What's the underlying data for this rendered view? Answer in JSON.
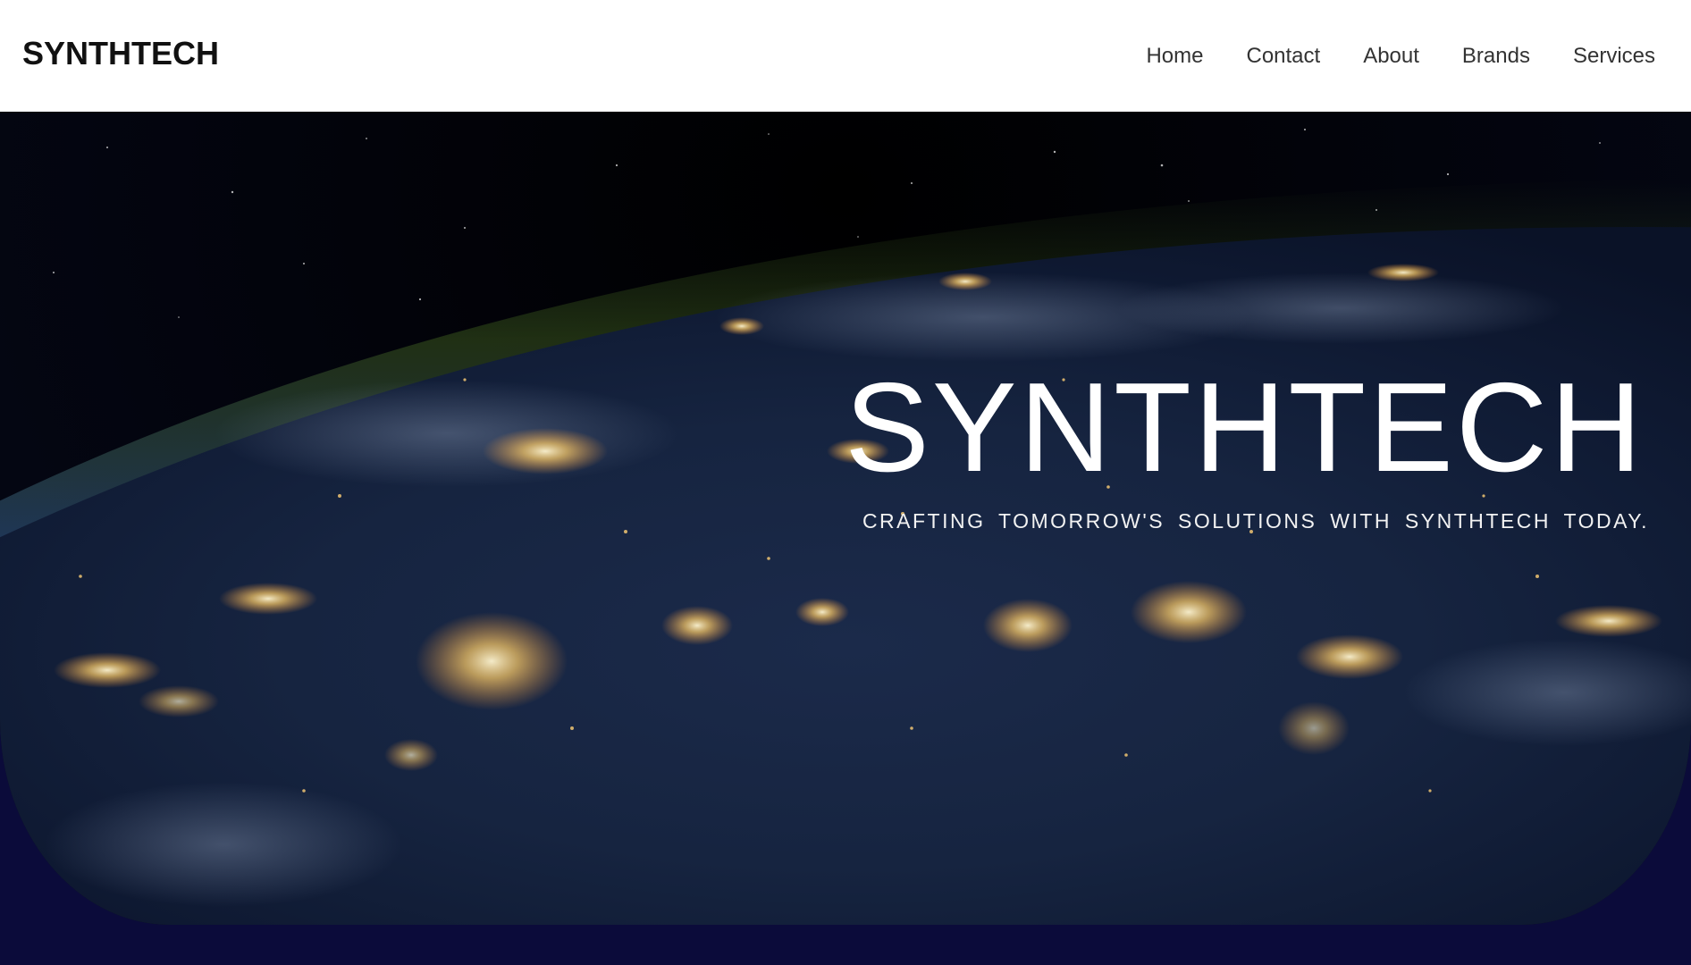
{
  "header": {
    "logo": "SYNTHTECH",
    "nav": [
      {
        "label": "Home"
      },
      {
        "label": "Contact"
      },
      {
        "label": "About"
      },
      {
        "label": "Brands"
      },
      {
        "label": "Services"
      }
    ]
  },
  "hero": {
    "title": "SYNTHTECH",
    "subtitle": "CRAFTING TOMORROW'S SOLUTIONS WITH SYNTHTECH TODAY.",
    "image": "earth-at-night-from-space"
  },
  "colors": {
    "header_bg": "#ffffff",
    "page_bg": "#0b0b3a",
    "hero_text": "#ffffff"
  }
}
